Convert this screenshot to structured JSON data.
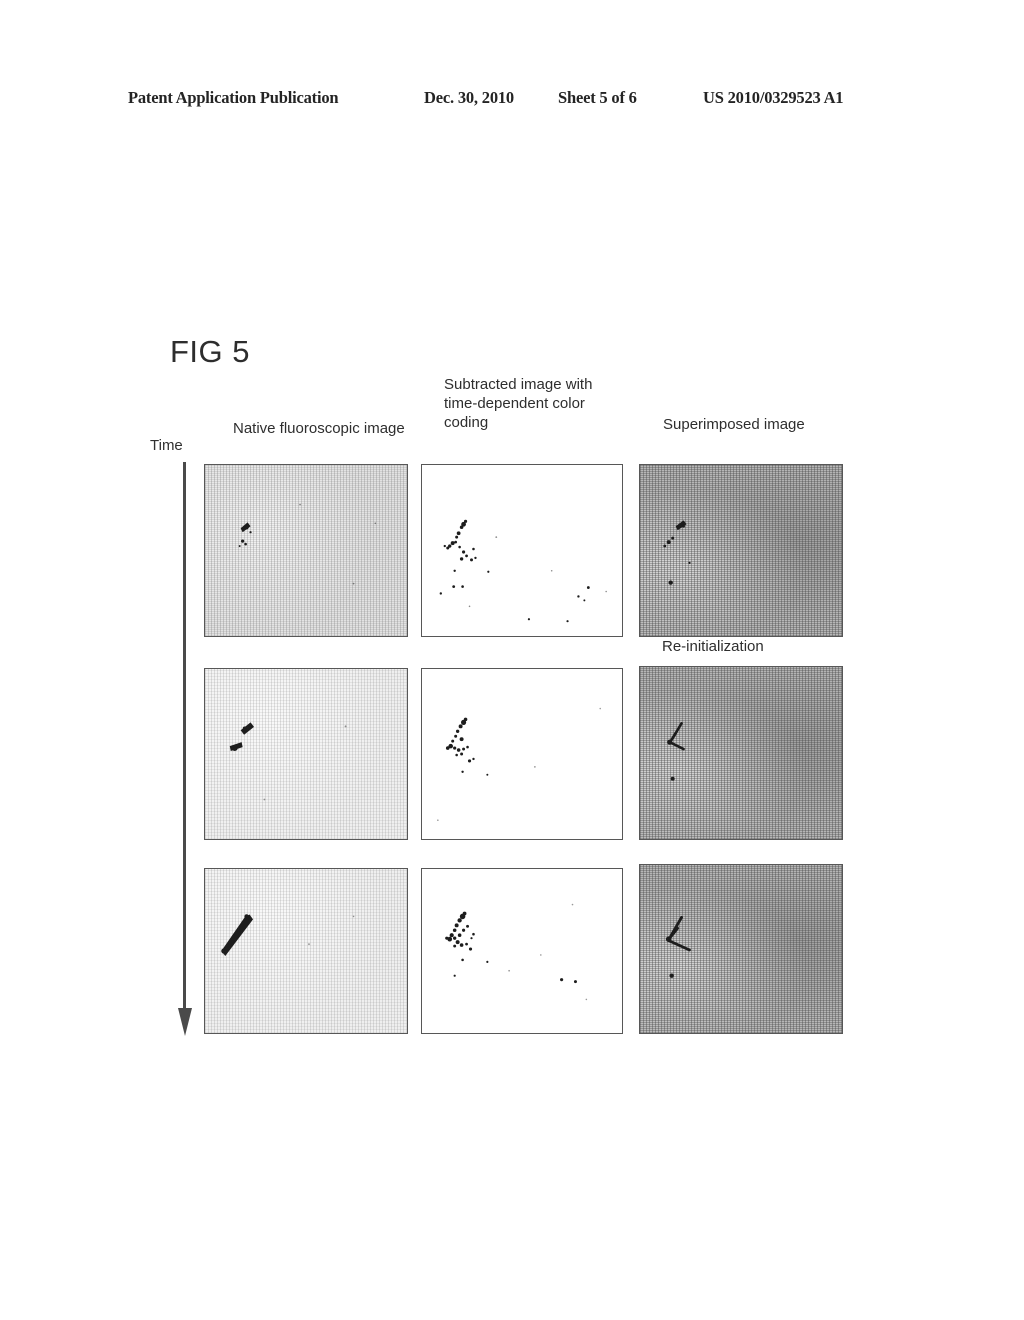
{
  "header": {
    "publication": "Patent Application Publication",
    "date": "Dec. 30, 2010",
    "sheet": "Sheet 5 of 6",
    "patent_number": "US 2010/0329523 A1"
  },
  "figure": {
    "title": "FIG 5",
    "time_axis_label": "Time",
    "reinitialization_label": "Re-initialization",
    "columns": [
      {
        "label": "Native fluoroscopic image"
      },
      {
        "label": "Subtracted image with time-dependent color coding"
      },
      {
        "label": "Superimposed image"
      }
    ],
    "rows": [
      {
        "panels": [
          {
            "kind": "native-fluoroscopic",
            "appearance": "light-gray-noise"
          },
          {
            "kind": "subtracted-color-coded",
            "appearance": "white"
          },
          {
            "kind": "superimposed",
            "appearance": "medium-gray-noise"
          }
        ]
      },
      {
        "panels": [
          {
            "kind": "native-fluoroscopic",
            "appearance": "light-gray-noise"
          },
          {
            "kind": "subtracted-color-coded",
            "appearance": "white"
          },
          {
            "kind": "superimposed",
            "appearance": "medium-gray-noise"
          }
        ]
      },
      {
        "panels": [
          {
            "kind": "native-fluoroscopic",
            "appearance": "light-gray-noise"
          },
          {
            "kind": "subtracted-color-coded",
            "appearance": "white"
          },
          {
            "kind": "superimposed",
            "appearance": "medium-gray-noise"
          }
        ]
      }
    ]
  },
  "colors": {
    "ink": "#2e2e2e",
    "panel_border": "#575757",
    "arrow": "#4a4a4a",
    "vessel": "#1d1d1d",
    "page_background": "#ffffff"
  }
}
